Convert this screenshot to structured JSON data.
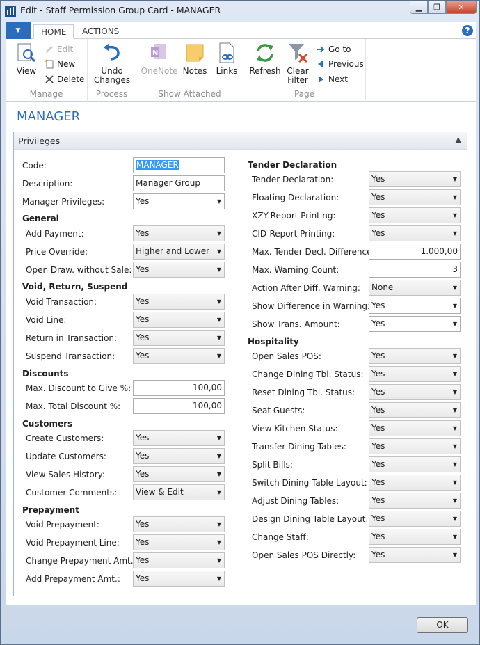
{
  "window": {
    "title": "Edit - Staff Permission Group Card - MANAGER",
    "minimize": "▁",
    "restore": "❐",
    "close": "✕"
  },
  "ribbon_tabs": {
    "menu": "▼",
    "home": "HOME",
    "actions": "ACTIONS",
    "help": "?"
  },
  "ribbon": {
    "manage": {
      "label": "Manage",
      "view": "View",
      "edit": "Edit",
      "new": "New",
      "delete": "Delete"
    },
    "process": {
      "label": "Process",
      "undo": "Undo Changes"
    },
    "show_attached": {
      "label": "Show Attached",
      "onenote": "OneNote",
      "notes": "Notes",
      "links": "Links"
    },
    "page": {
      "label": "Page",
      "refresh": "Refresh",
      "clear_filter": "Clear Filter",
      "goto": "Go to",
      "previous": "Previous",
      "next": "Next"
    }
  },
  "page_title": "MANAGER",
  "fasttab": {
    "title": "Privileges",
    "chevron": "▲"
  },
  "left": {
    "code": {
      "label": "Code:",
      "value": "MANAGER"
    },
    "description": {
      "label": "Description:",
      "value": "Manager Group"
    },
    "manager_privileges": {
      "label": "Manager Privileges:",
      "value": "Yes"
    },
    "groups": [
      {
        "title": "General",
        "fields": [
          {
            "label": "Add Payment:",
            "value": "Yes"
          },
          {
            "label": "Price Override:",
            "value": "Higher and Lower"
          },
          {
            "label": "Open Draw. without Sale:",
            "value": "Yes"
          }
        ]
      },
      {
        "title": "Void, Return, Suspend",
        "fields": [
          {
            "label": "Void Transaction:",
            "value": "Yes"
          },
          {
            "label": "Void Line:",
            "value": "Yes"
          },
          {
            "label": "Return in Transaction:",
            "value": "Yes"
          },
          {
            "label": "Suspend Transaction:",
            "value": "Yes"
          }
        ]
      },
      {
        "title": "Discounts",
        "fields": [
          {
            "label": "Max. Discount to Give %:",
            "value": "100,00"
          },
          {
            "label": "Max. Total Discount %:",
            "value": "100,00"
          }
        ]
      },
      {
        "title": "Customers",
        "fields": [
          {
            "label": "Create Customers:",
            "value": "Yes"
          },
          {
            "label": "Update Customers:",
            "value": "Yes"
          },
          {
            "label": "View Sales History:",
            "value": "Yes"
          },
          {
            "label": "Customer Comments:",
            "value": "View & Edit"
          }
        ]
      },
      {
        "title": "Prepayment",
        "fields": [
          {
            "label": "Void Prepayment:",
            "value": "Yes"
          },
          {
            "label": "Void Prepayment Line:",
            "value": "Yes"
          },
          {
            "label": "Change Prepayment Amt.:",
            "value": "Yes"
          },
          {
            "label": "Add Prepayment Amt.:",
            "value": "Yes"
          }
        ]
      }
    ]
  },
  "right": {
    "groups": [
      {
        "title": "Tender Declaration",
        "fields": [
          {
            "label": "Tender Declaration:",
            "value": "Yes"
          },
          {
            "label": "Floating Declaration:",
            "value": "Yes"
          },
          {
            "label": "XZY-Report Printing:",
            "value": "Yes"
          },
          {
            "label": "CID-Report Printing:",
            "value": "Yes"
          },
          {
            "label": "Max. Tender Decl. Difference:",
            "value": "1.000,00"
          },
          {
            "label": "Max. Warning Count:",
            "value": "3"
          },
          {
            "label": "Action After Diff. Warning:",
            "value": "None"
          },
          {
            "label": "Show Difference in Warning:",
            "value": "Yes"
          },
          {
            "label": "Show Trans. Amount:",
            "value": "Yes"
          }
        ]
      },
      {
        "title": "Hospitality",
        "fields": [
          {
            "label": "Open Sales POS:",
            "value": "Yes"
          },
          {
            "label": "Change Dining Tbl. Status:",
            "value": "Yes"
          },
          {
            "label": "Reset Dining Tbl. Status:",
            "value": "Yes"
          },
          {
            "label": "Seat Guests:",
            "value": "Yes"
          },
          {
            "label": "View Kitchen Status:",
            "value": "Yes"
          },
          {
            "label": "Transfer Dining Tables:",
            "value": "Yes"
          },
          {
            "label": "Split Bills:",
            "value": "Yes"
          },
          {
            "label": "Switch Dining Table Layout:",
            "value": "Yes"
          },
          {
            "label": "Adjust Dining Tables:",
            "value": "Yes"
          },
          {
            "label": "Design Dining Table Layout:",
            "value": "Yes"
          },
          {
            "label": "Change Staff:",
            "value": "Yes"
          },
          {
            "label": "Open Sales POS Directly:",
            "value": "Yes"
          }
        ]
      }
    ]
  },
  "ok_button": "OK",
  "dropdown_arrow": "▼",
  "colors": {
    "accent": "#2a6dbd",
    "panel_border": "#9db6d9",
    "frame": "#c9d7ea"
  }
}
